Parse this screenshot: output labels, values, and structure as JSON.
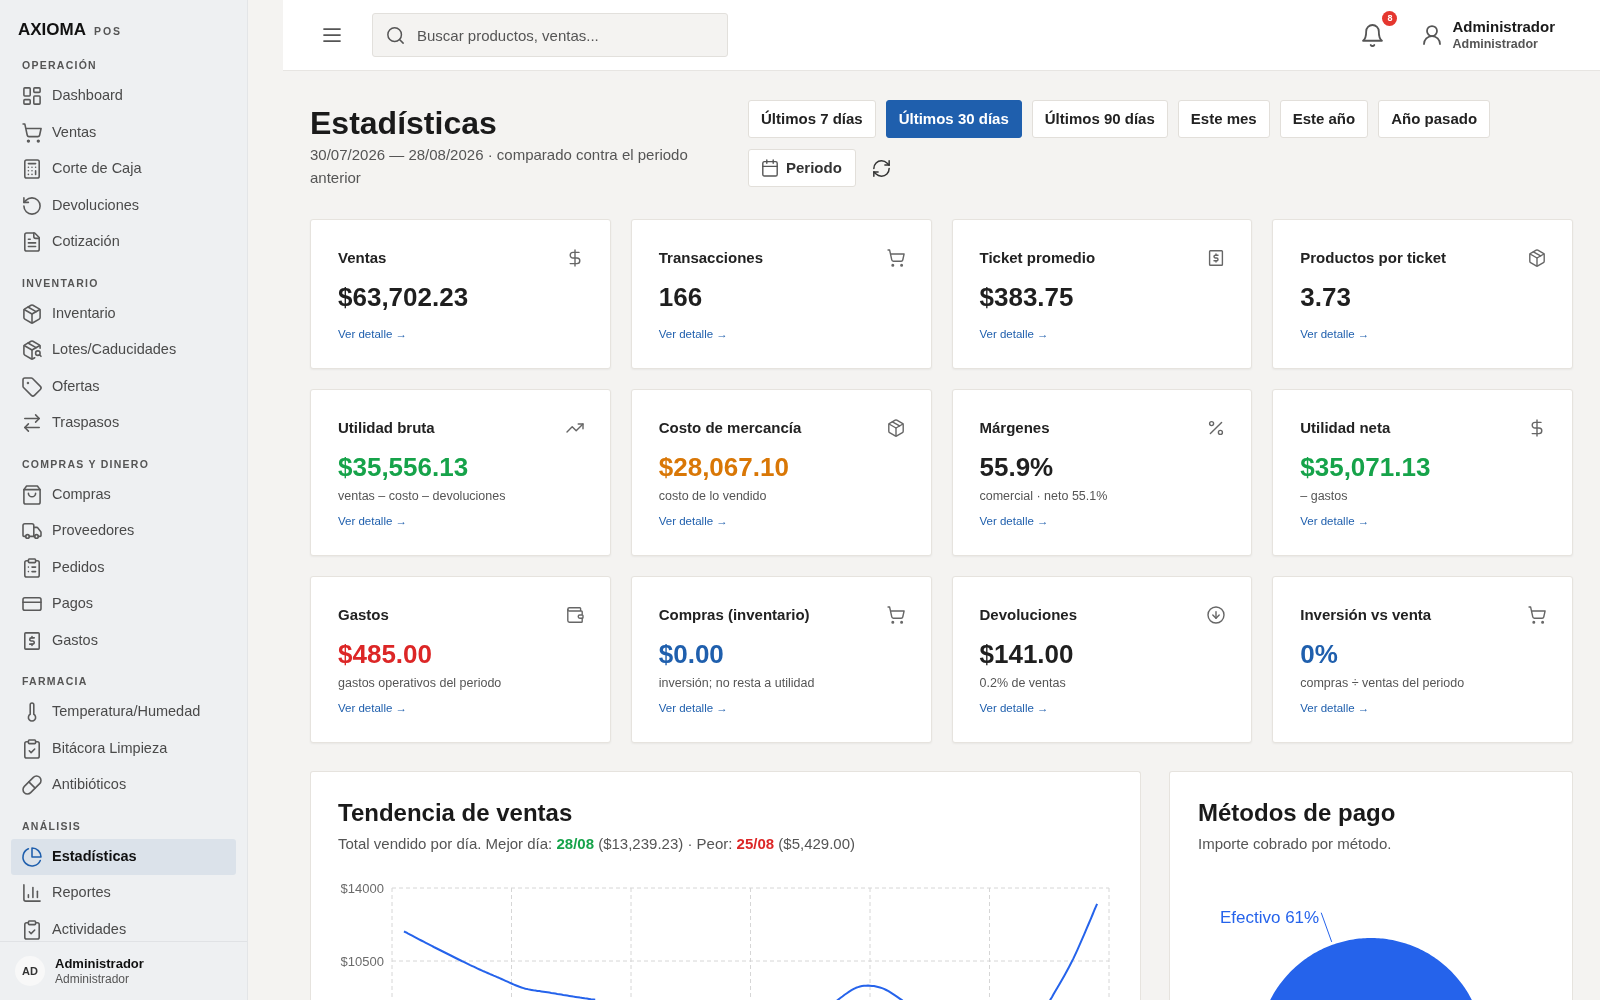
{
  "sidebar": {
    "brand": {
      "name": "AXIOMA",
      "tag": "POS"
    },
    "sections": [
      {
        "title": "OPERACIÓN",
        "items": [
          {
            "label": "Dashboard",
            "selected": false
          },
          {
            "label": "Ventas",
            "selected": false
          },
          {
            "label": "Corte de Caja",
            "selected": false
          },
          {
            "label": "Devoluciones",
            "selected": false
          },
          {
            "label": "Cotización",
            "selected": false
          }
        ]
      },
      {
        "title": "INVENTARIO",
        "items": [
          {
            "label": "Inventario",
            "selected": false
          },
          {
            "label": "Lotes/Caducidades",
            "selected": false
          },
          {
            "label": "Ofertas",
            "selected": false
          },
          {
            "label": "Traspasos",
            "selected": false
          }
        ]
      },
      {
        "title": "COMPRAS Y DINERO",
        "items": [
          {
            "label": "Compras",
            "selected": false
          },
          {
            "label": "Proveedores",
            "selected": false
          },
          {
            "label": "Pedidos",
            "selected": false
          },
          {
            "label": "Pagos",
            "selected": false
          },
          {
            "label": "Gastos",
            "selected": false
          }
        ]
      },
      {
        "title": "FARMACIA",
        "items": [
          {
            "label": "Temperatura/Humedad",
            "selected": false
          },
          {
            "label": "Bitácora Limpieza",
            "selected": false
          },
          {
            "label": "Antibióticos",
            "selected": false
          }
        ]
      },
      {
        "title": "ANÁLISIS",
        "items": [
          {
            "label": "Estadísticas",
            "selected": true
          },
          {
            "label": "Reportes",
            "selected": false
          },
          {
            "label": "Actividades",
            "selected": false
          }
        ]
      }
    ],
    "user": {
      "initials": "AD",
      "name": "Administrador",
      "role": "Administrador"
    }
  },
  "header": {
    "search": {
      "placeholder": "Buscar productos, ventas..."
    },
    "notifications": {
      "badge": "8"
    },
    "user": {
      "name": "Administrador",
      "role": "Administrador"
    }
  },
  "page": {
    "title": "Estadísticas",
    "subtitle": "30/07/2026 — 28/08/2026 · comparado contra el periodo anterior",
    "ranges": [
      {
        "label": "Últimos 7 días",
        "selected": false
      },
      {
        "label": "Últimos 30 días",
        "selected": true
      },
      {
        "label": "Últimos 90 días",
        "selected": false
      },
      {
        "label": "Este mes",
        "selected": false
      },
      {
        "label": "Este año",
        "selected": false
      },
      {
        "label": "Año pasado",
        "selected": false
      }
    ],
    "period_button": "Periodo"
  },
  "metrics": [
    {
      "title": "Ventas",
      "value": "$63,702.23",
      "color": "#1f1f1f",
      "link": "Ver detalle →"
    },
    {
      "title": "Transacciones",
      "value": "166",
      "color": "#1f1f1f",
      "link": "Ver detalle →"
    },
    {
      "title": "Ticket promedio",
      "value": "$383.75",
      "color": "#1f1f1f",
      "link": "Ver detalle →"
    },
    {
      "title": "Productos por ticket",
      "value": "3.73",
      "color": "#1f1f1f",
      "link": "Ver detalle →"
    },
    {
      "title": "Utilidad bruta",
      "value": "$35,556.13",
      "color": "#16a34a",
      "note": "ventas – costo – devoluciones",
      "link": "Ver detalle →"
    },
    {
      "title": "Costo de mercancía",
      "value": "$28,067.10",
      "color": "#d97706",
      "note": "costo de lo vendido",
      "link": "Ver detalle →"
    },
    {
      "title": "Márgenes",
      "value": "55.9%",
      "color": "#1f1f1f",
      "note": "comercial · neto 55.1%",
      "link": "Ver detalle →"
    },
    {
      "title": "Utilidad neta",
      "value": "$35,071.13",
      "color": "#16a34a",
      "note": "– gastos",
      "link": "Ver detalle →"
    },
    {
      "title": "Gastos",
      "value": "$485.00",
      "color": "#dc2626",
      "note": "gastos operativos del periodo",
      "link": "Ver detalle →"
    },
    {
      "title": "Compras (inventario)",
      "value": "$0.00",
      "color": "#1f5fad",
      "note": "inversión; no resta a utilidad",
      "link": "Ver detalle →"
    },
    {
      "title": "Devoluciones",
      "value": "$141.00",
      "color": "#1f1f1f",
      "note": "0.2% de ventas",
      "link": "Ver detalle →"
    },
    {
      "title": "Inversión vs venta",
      "value": "0%",
      "color": "#1f5fad",
      "note": "compras ÷ ventas del periodo",
      "link": "Ver detalle →"
    }
  ],
  "sales_trend": {
    "title": "Tendencia de ventas",
    "subtitle": [
      {
        "text": "Total vendido por día. Mejor día: ",
        "bold": false,
        "color": "#555555"
      },
      {
        "text": "28/08",
        "bold": true,
        "color": "#16a34a"
      },
      {
        "text": " ($13,239.23) · Peor: ",
        "bold": false,
        "color": "#555555"
      },
      {
        "text": "25/08",
        "bold": true,
        "color": "#dc2626"
      },
      {
        "text": " ($5,429.00)",
        "bold": false,
        "color": "#555555"
      }
    ],
    "chart_data": {
      "type": "line",
      "categories": [
        null,
        null,
        null,
        null,
        null,
        null,
        null,
        null,
        null,
        null,
        null,
        null,
        null,
        null,
        null,
        null,
        null,
        null,
        null,
        null,
        null,
        null,
        null,
        null,
        null,
        null,
        null,
        null,
        null,
        null
      ],
      "ylim": [
        8400,
        14000
      ],
      "yticks": [
        {
          "value": 14000,
          "label": "$14000"
        },
        {
          "value": 10500,
          "label": "$10500"
        }
      ],
      "series": [
        {
          "color": "#2563eb",
          "values": [
            11920,
            11320,
            10740,
            10180,
            9680,
            9200,
            9000,
            8810,
            8640,
            null,
            null,
            null,
            null,
            null,
            null,
            null,
            null,
            null,
            8500,
            9250,
            9200,
            8490,
            null,
            null,
            null,
            null,
            null,
            8550,
            10600,
            13240
          ]
        }
      ]
    }
  },
  "payment_methods": {
    "title": "Métodos de pago",
    "subtitle": "Importe cobrado por método.",
    "chart_data": {
      "type": "pie",
      "categories": [
        "Efectivo"
      ],
      "values": [
        61
      ],
      "value_labels": [
        "61%"
      ]
    }
  }
}
